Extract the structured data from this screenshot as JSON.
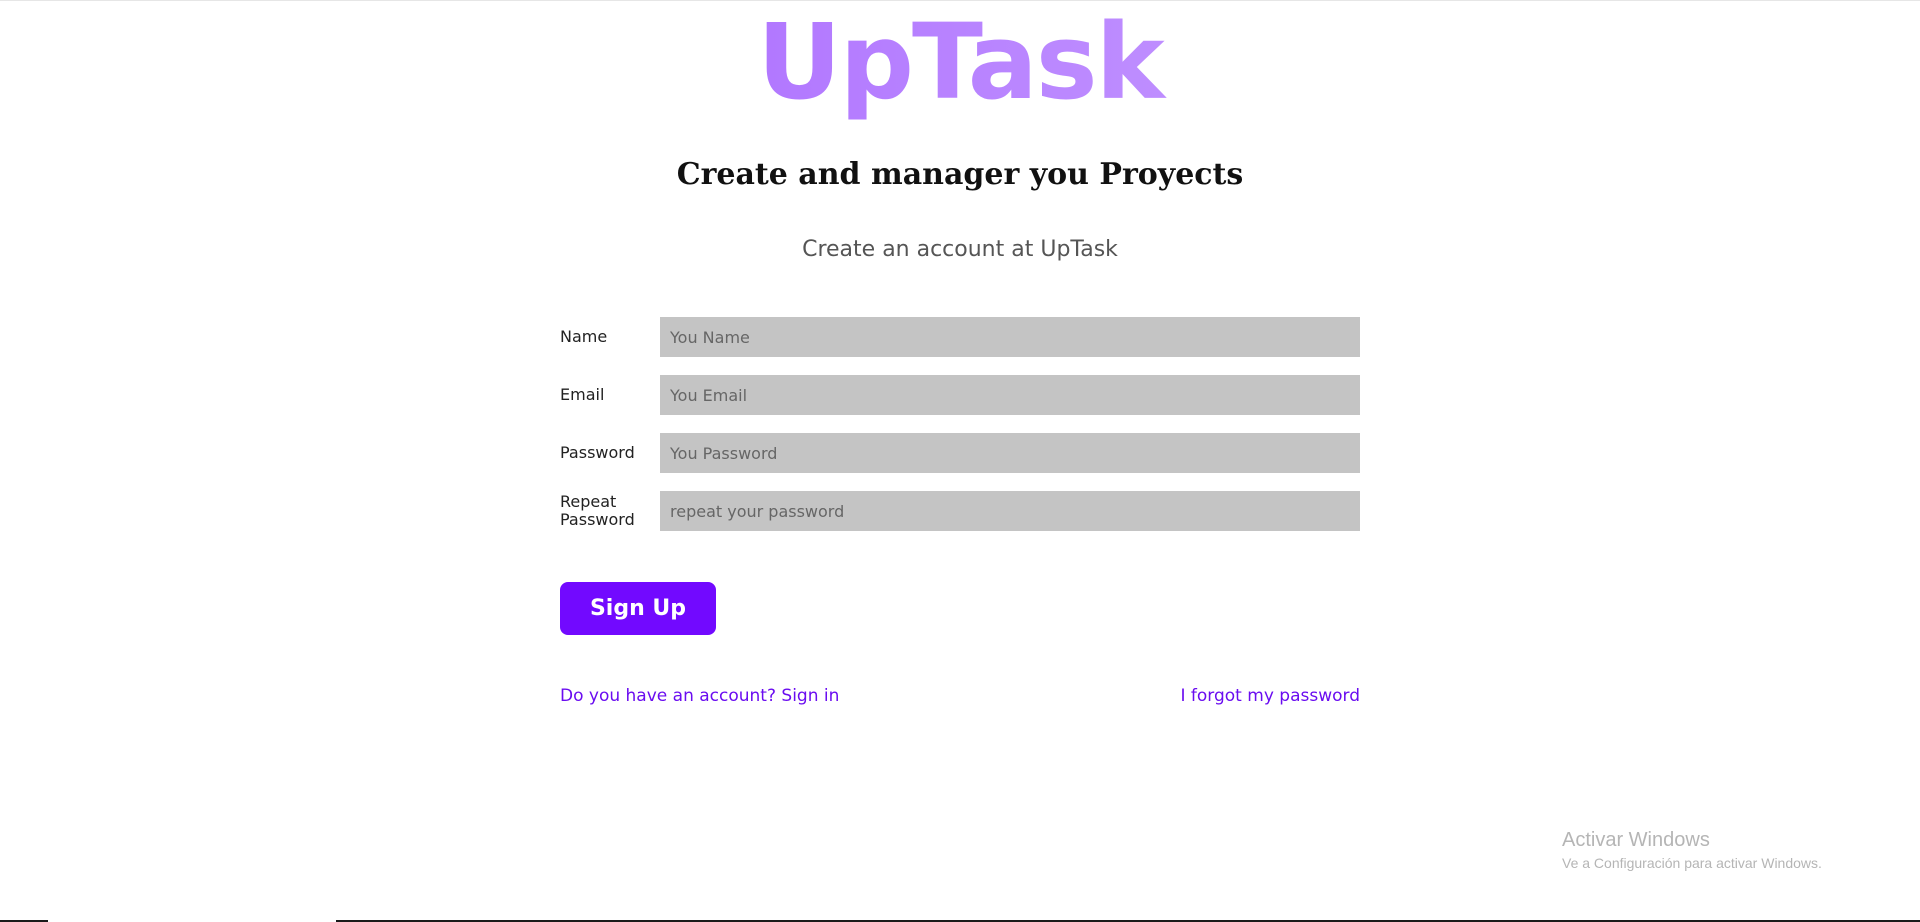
{
  "logo": {
    "text": "UpTask"
  },
  "headline": "Create and manager you Proyects",
  "subhead": "Create an account at UpTask",
  "form": {
    "fields": [
      {
        "label": "Name",
        "placeholder": "You Name"
      },
      {
        "label": "Email",
        "placeholder": "You Email"
      },
      {
        "label": "Password",
        "placeholder": "You Password"
      },
      {
        "label": "Repeat Password",
        "placeholder": "repeat your password"
      }
    ],
    "submit_label": "Sign Up"
  },
  "links": {
    "sign_in": "Do you have an account? Sign in",
    "forgot": "I forgot my password"
  },
  "watermark": {
    "title": "Activar Windows",
    "subtitle": "Ve a Configuración para activar Windows."
  },
  "colors": {
    "accent": "#7209ff",
    "link": "#6a0cf0",
    "input_bg": "#c4c4c4"
  }
}
